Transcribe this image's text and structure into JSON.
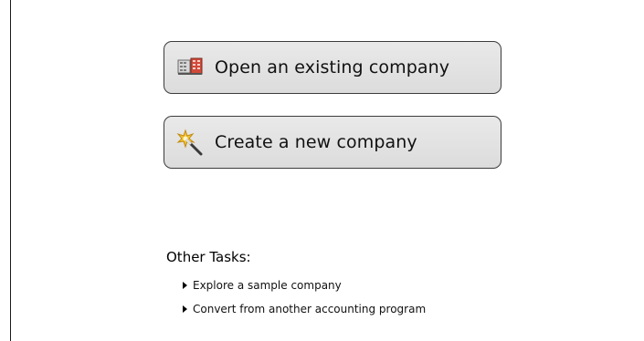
{
  "actions": {
    "open_label": "Open an existing company",
    "create_label": "Create a new company"
  },
  "icons": {
    "open": "company-files-icon",
    "create": "magic-wand-icon"
  },
  "other_tasks": {
    "title": "Other Tasks:",
    "items": [
      {
        "label": "Explore a sample company"
      },
      {
        "label": "Convert from another accounting program"
      }
    ]
  },
  "colors": {
    "button_bg": "#e2e2e2",
    "button_border": "#3c3c3c",
    "text": "#111111"
  }
}
